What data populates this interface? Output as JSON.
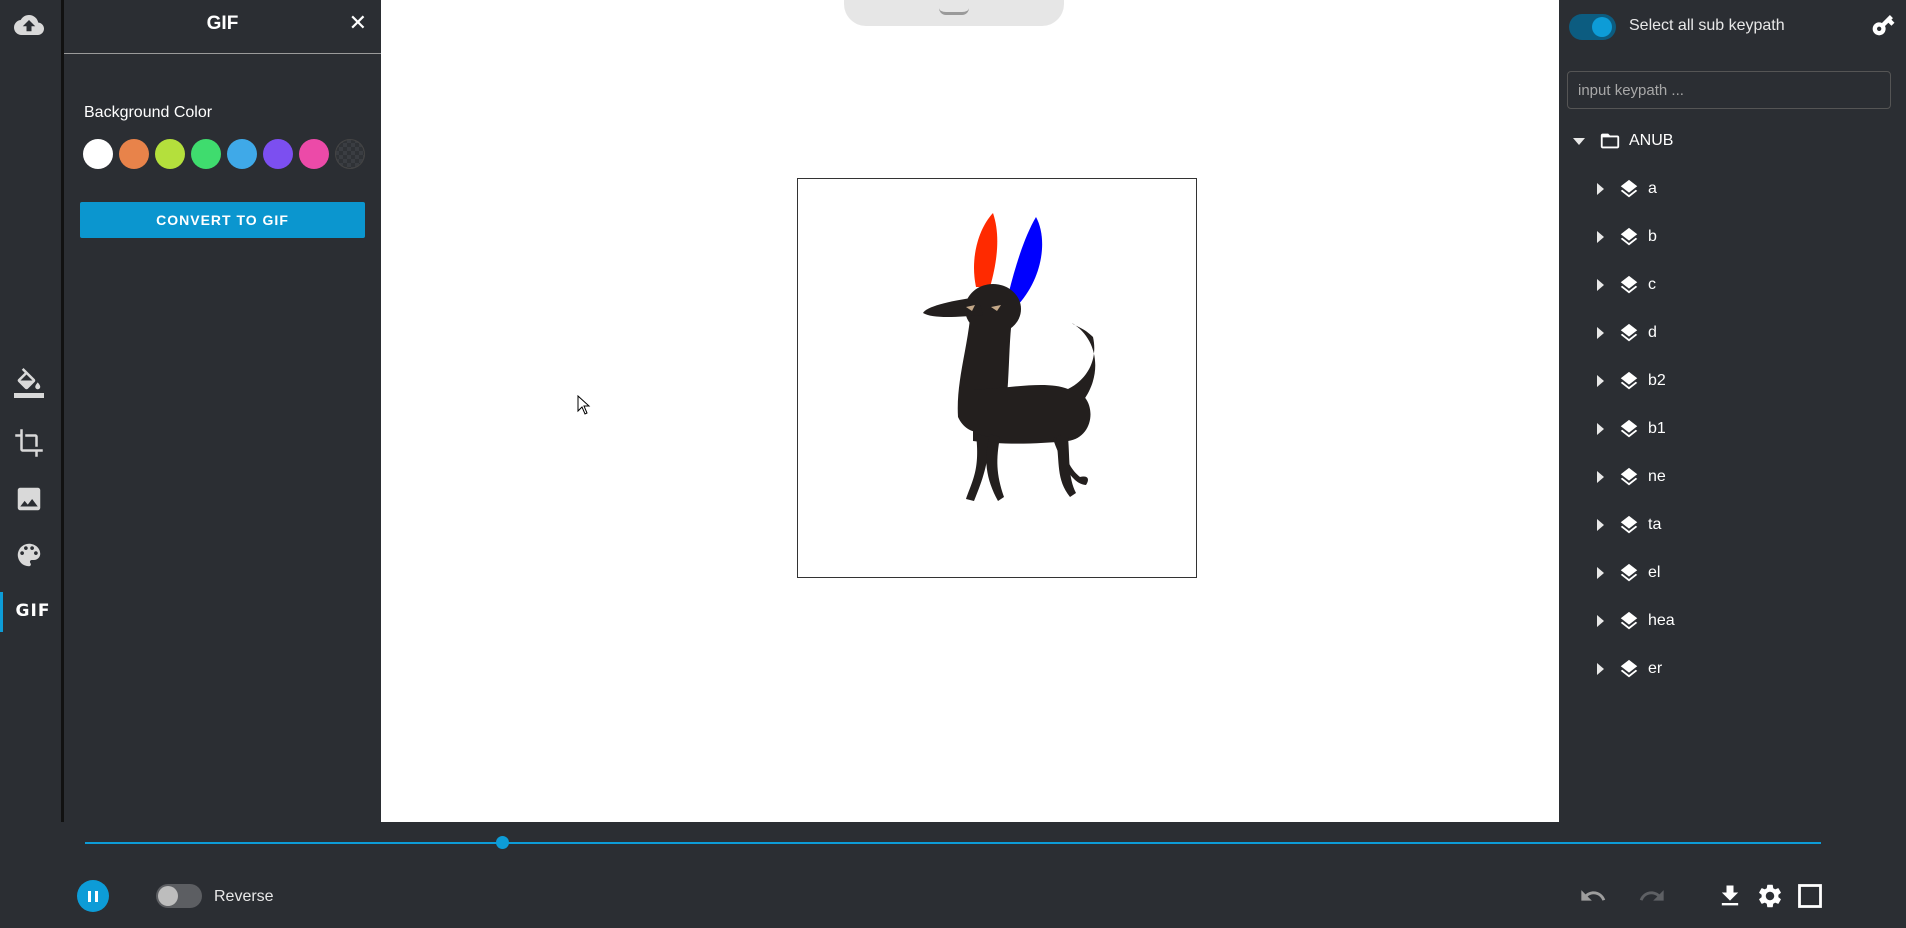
{
  "rail": {
    "items": [
      {
        "name": "upload-icon"
      },
      {
        "name": "paint-bucket-icon"
      },
      {
        "name": "crop-icon"
      },
      {
        "name": "image-icon"
      },
      {
        "name": "palette-icon"
      },
      {
        "name": "gif-icon",
        "label": "GIF",
        "active": true
      }
    ]
  },
  "gif_panel": {
    "title": "GIF",
    "close_glyph": "✕",
    "bg_color_label": "Background Color",
    "swatches": [
      "#ffffff",
      "#e8834a",
      "#b4e03c",
      "#3fdc6e",
      "#3fa9e8",
      "#7c4ff0",
      "#ec4aa8",
      "transparent"
    ],
    "convert_label": "CONVERT TO GIF"
  },
  "right_panel": {
    "select_all_label": "Select all sub keypath",
    "keypath_placeholder": "input keypath ...",
    "root": {
      "label": "ANUB",
      "icon": "folder-open-icon"
    },
    "layers": [
      {
        "label": "a"
      },
      {
        "label": "b"
      },
      {
        "label": "c"
      },
      {
        "label": "d"
      },
      {
        "label": "b2"
      },
      {
        "label": "b1"
      },
      {
        "label": "ne"
      },
      {
        "label": "ta"
      },
      {
        "label": "el"
      },
      {
        "label": "hea"
      },
      {
        "label": "er"
      }
    ]
  },
  "player": {
    "progress": 0.24,
    "reverse_label": "Reverse",
    "reverse_on": false
  },
  "colors": {
    "accent": "#0d9cd7",
    "panel_bg": "#2b2e33"
  }
}
